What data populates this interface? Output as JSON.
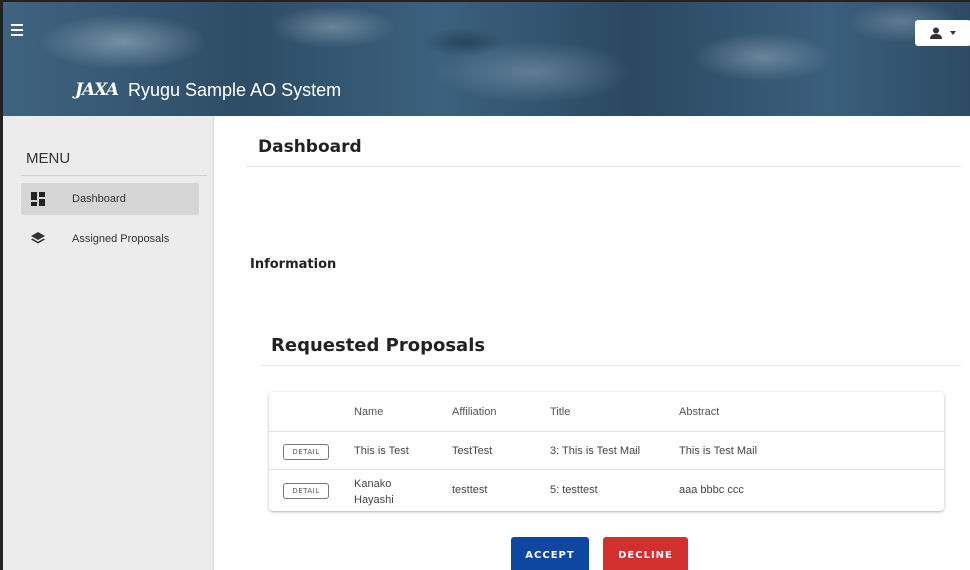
{
  "header": {
    "logo_text": "JAXA",
    "app_title": "Ryugu Sample AO System",
    "user_menu_icon": "user-icon"
  },
  "sidebar": {
    "heading": "MENU",
    "items": [
      {
        "label": "Dashboard",
        "icon": "dashboard-icon",
        "active": true
      },
      {
        "label": "Assigned Proposals",
        "icon": "layers-icon",
        "active": false
      }
    ]
  },
  "main": {
    "page_title": "Dashboard",
    "information_heading": "Information",
    "requested_heading": "Requested Proposals",
    "table": {
      "columns": [
        "",
        "Name",
        "Affiliation",
        "Title",
        "Abstract"
      ],
      "rows": [
        {
          "button": "DETAIL",
          "name": "This is Test",
          "affiliation": "TestTest",
          "title": "3: This is Test Mail",
          "abstract": "This is Test Mail"
        },
        {
          "button": "DETAIL",
          "name_line1": "Kanako",
          "name_line2": "Hayashi",
          "affiliation": "testtest",
          "title": "5: testtest",
          "abstract": "aaa bbbc ccc"
        }
      ]
    },
    "actions": {
      "accept": "ACCEPT",
      "decline": "DECLINE"
    }
  },
  "colors": {
    "accept": "#0e47a1",
    "decline": "#d32f2f",
    "sidebar_bg": "#ececec",
    "header_bg": "#2d4c66"
  }
}
